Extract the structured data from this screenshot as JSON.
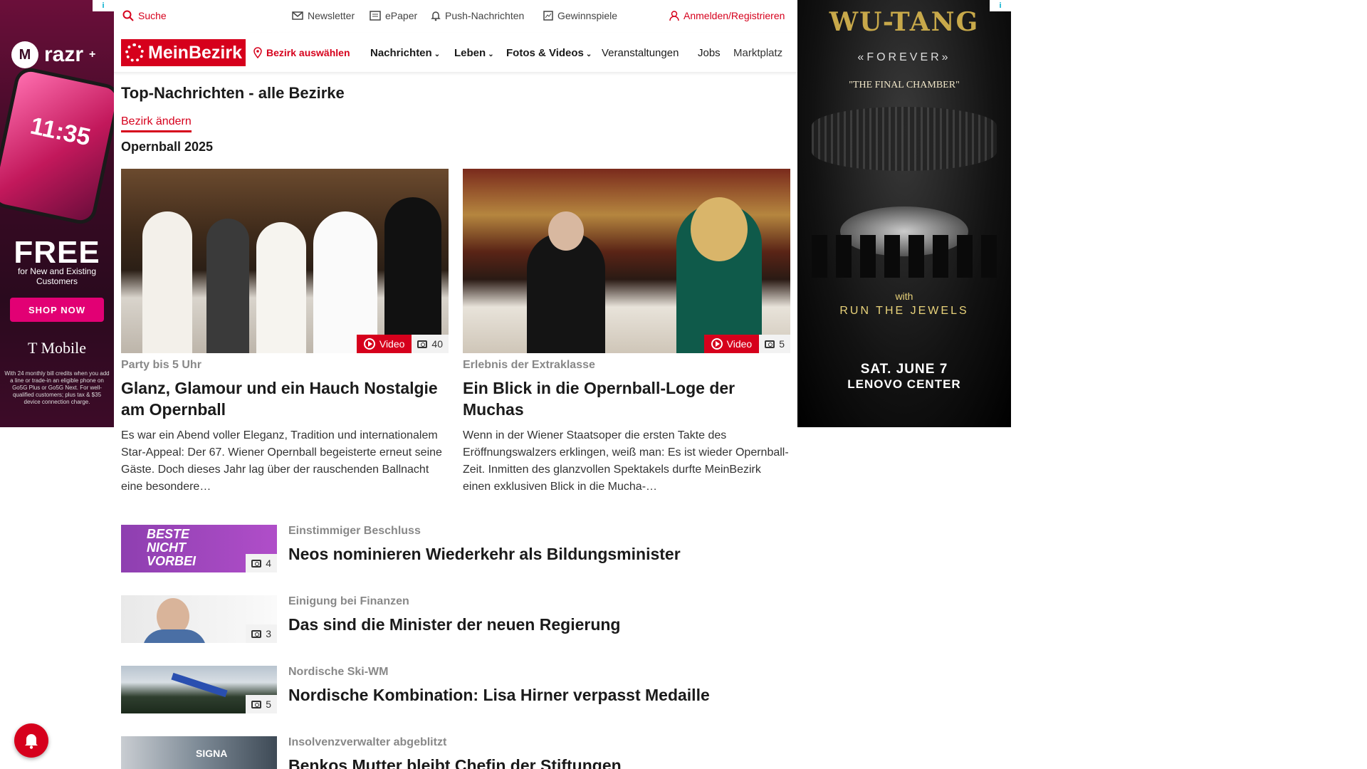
{
  "ad_left": {
    "brand": "razr",
    "brand_plus": "+",
    "phone_time": "11:35",
    "headline": "FREE",
    "sub": "for New and Existing Customers",
    "cta": "SHOP NOW",
    "advertiser": "T Mobile",
    "fineprint": "With 24 monthly bill credits when you add a line or trade-in an eligible phone on Go5G Plus or Go5G Next. For well-qualified customers; plus tax & $35 device connection charge.",
    "adchoice": "i"
  },
  "ad_right": {
    "title": "WU-TANG",
    "forever": "«FOREVER»",
    "subtitle": "\"THE FINAL CHAMBER\"",
    "with": "with",
    "support": "RUN THE JEWELS",
    "date": "SAT. JUNE 7",
    "venue": "LENOVO CENTER",
    "adchoice": "i"
  },
  "topbar": {
    "search": "Suche",
    "newsletter": "Newsletter",
    "epaper": "ePaper",
    "push": "Push-Nachrichten",
    "contests": "Gewinnspiele",
    "login": "Anmelden/Registrieren"
  },
  "nav": {
    "logo": "MeinBezirk",
    "district": "Bezirk auswählen",
    "items": [
      "Nachrichten",
      "Leben",
      "Fotos & Videos",
      "Veranstaltungen",
      "Jobs",
      "Marktplatz"
    ]
  },
  "main": {
    "title": "Top-Nachrichten - alle Bezirke",
    "change_district": "Bezirk ändern",
    "section": "Opernball 2025",
    "cards": [
      {
        "kicker": "Party bis 5 Uhr",
        "headline": "Glanz, Glamour und ein Hauch Nostalgie am Opernball",
        "teaser": "Es war ein Abend voller Eleganz, Tradition und internationalem Star-Appeal: Der 67. Wiener Opernball begeisterte erneut seine Gäste. Doch dieses Jahr lag über der rauschenden Ballnacht eine besondere…",
        "video_label": "Video",
        "count": "40"
      },
      {
        "kicker": "Erlebnis der Extraklasse",
        "headline": "Ein Blick in die Opernball-Loge der Muchas",
        "teaser": "Wenn in der Wiener Staatsoper die ersten Takte des Eröffnungswalzers erklingen, weiß man: Es ist wieder Opernball-Zeit. Inmitten des glanzvollen Spektakels durfte MeinBezirk einen exklusiven Blick in die Mucha-…",
        "video_label": "Video",
        "count": "5"
      }
    ],
    "list": [
      {
        "kicker": "Einstimmiger Beschluss",
        "headline": "Neos nominieren Wiederkehr als Bildungsminister",
        "count": "4",
        "thumb_text": "BESTE NICHT VORBEI"
      },
      {
        "kicker": "Einigung bei Finanzen",
        "headline": "Das sind die Minister der neuen Regierung",
        "count": "3",
        "thumb_text": ""
      },
      {
        "kicker": "Nordische Ski-WM",
        "headline": "Nordische Kombination: Lisa Hirner verpasst Medaille",
        "count": "5",
        "thumb_text": ""
      },
      {
        "kicker": "Insolvenzverwalter abgeblitzt",
        "headline": "Benkos Mutter bleibt Chefin der Stiftungen",
        "count": "",
        "thumb_text": "SIGNA"
      }
    ]
  },
  "colors": {
    "accent": "#d6001c",
    "muted": "#888888"
  }
}
